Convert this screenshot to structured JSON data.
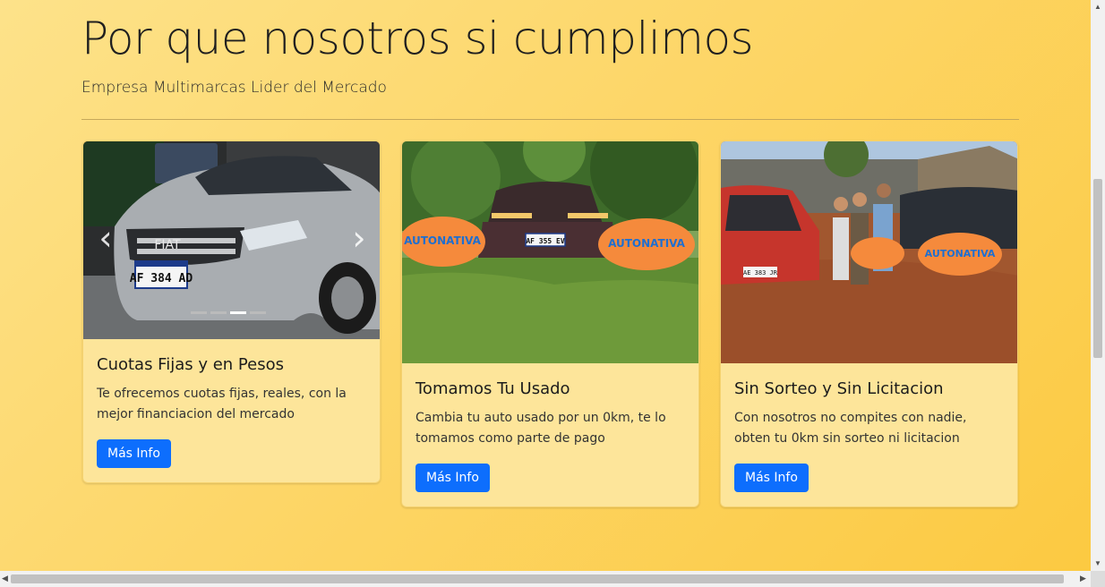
{
  "section": {
    "title": "Por que nosotros si cumplimos",
    "subtitle": "Empresa Multimarcas Lider del Mercado"
  },
  "cards": [
    {
      "title": "Cuotas Fijas y en Pesos",
      "text": "Te ofrecemos cuotas fijas, reales, con la mejor financiacion del mercado",
      "button": "Más Info",
      "image": {
        "plate": "AF 384 AD",
        "badge": "FIAT",
        "type": "carousel"
      }
    },
    {
      "title": "Tomamos Tu Usado",
      "text": "Cambia tu auto usado por un 0km, te lo tomamos como parte de pago",
      "button": "Más Info",
      "image": {
        "plate": "AF 355 EV",
        "brand": "AUTONATIVA"
      }
    },
    {
      "title": "Sin Sorteo y Sin Licitacion",
      "text": "Con nosotros no compites con nadie, obten tu 0km sin sorteo ni licitacion",
      "button": "Más Info",
      "image": {
        "plate": "AE 383 JR",
        "brand": "AUTONATIVA"
      }
    }
  ],
  "carousel": {
    "prev_icon": "chevron-left-icon",
    "next_icon": "chevron-right-icon"
  },
  "colors": {
    "accent": "#0d6efd",
    "background": "#fdd668",
    "card": "#fde59a",
    "banner": "#f58a3c",
    "banner_text": "#1f6fd0"
  }
}
